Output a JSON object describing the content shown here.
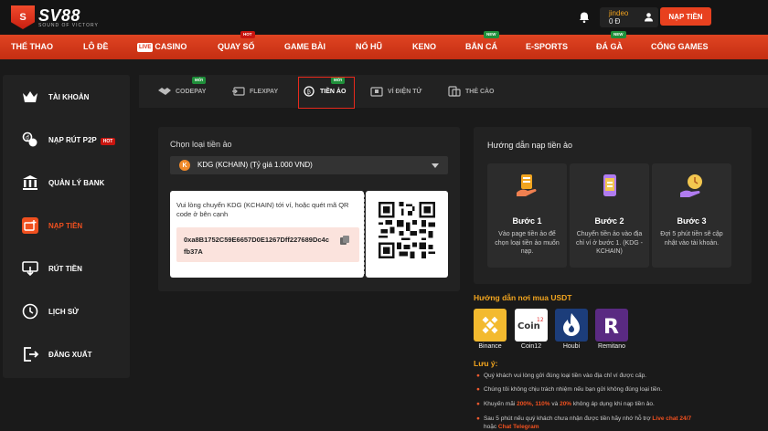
{
  "header": {
    "logo_text": "SV88",
    "logo_tagline": "SOUND OF VICTORY",
    "username": "jindeo",
    "balance": "0 Đ",
    "deposit_button": "NẠP TIỀN"
  },
  "nav": {
    "items": [
      {
        "label": "THỂ THAO"
      },
      {
        "label": "LÔ ĐỀ"
      },
      {
        "label": "CASINO",
        "live": "LIVE"
      },
      {
        "label": "QUAY SỐ",
        "badge": "HOT"
      },
      {
        "label": "GAME BÀI"
      },
      {
        "label": "NỔ HŨ"
      },
      {
        "label": "KENO"
      },
      {
        "label": "BẮN CÁ",
        "badge": "NEW"
      },
      {
        "label": "E-SPORTS"
      },
      {
        "label": "ĐÁ GÀ",
        "badge": "NEW"
      },
      {
        "label": "CỔNG GAMES"
      }
    ]
  },
  "sidebar": {
    "items": [
      {
        "label": "TÀI KHOẢN"
      },
      {
        "label": "NẠP RÚT P2P",
        "badge": "HOT"
      },
      {
        "label": "QUẢN LÝ BANK"
      },
      {
        "label": "NẠP TIỀN",
        "active": true
      },
      {
        "label": "RÚT TIỀN"
      },
      {
        "label": "LỊCH SỬ"
      },
      {
        "label": "ĐĂNG XUẤT"
      }
    ]
  },
  "tabs": {
    "items": [
      {
        "label": "CODEPAY",
        "badge": "MỚI"
      },
      {
        "label": "FLEXPAY"
      },
      {
        "label": "TIỀN ẢO",
        "badge": "MỚI",
        "active": true
      },
      {
        "label": "VÍ ĐIỆN TỬ"
      },
      {
        "label": "THẺ CÀO"
      }
    ]
  },
  "panel": {
    "label": "Chọn loại tiền ảo",
    "selected": "KDG (KCHAIN) (Tỷ giá 1.000 VND)",
    "instruction": "Vui lòng chuyển KDG (KCHAIN) tới ví, hoặc quét mã QR code ở bên cạnh",
    "address": "0xa8B1752C59E6657D0E1267Dff227689Dc4cfb37A"
  },
  "guide": {
    "title": "Hướng dẫn nạp tiền ảo",
    "steps": [
      {
        "title": "Bước 1",
        "desc": "Vào page tiền ảo để chọn loại tiền ảo muốn nạp."
      },
      {
        "title": "Bước 2",
        "desc": "Chuyển tiền ảo vào địa chỉ ví ở bước 1. (KDG - KCHAIN)"
      },
      {
        "title": "Bước 3",
        "desc": "Đợi 5 phút tiền sẽ cập nhật vào tài khoản."
      }
    ]
  },
  "buy": {
    "title": "Hướng dẫn nơi mua USDT",
    "exchanges": [
      {
        "name": "Binance",
        "color": "#f3ba2f"
      },
      {
        "name": "Coin12",
        "color": "#ffffff"
      },
      {
        "name": "Houbi",
        "color": "#1c3d7a"
      },
      {
        "name": "Remitano",
        "color": "#5a2a82"
      }
    ]
  },
  "notes": {
    "title": "Lưu ý:",
    "n1": "Quý khách vui lòng gửi đúng loại tiền vào địa chỉ ví được cấp.",
    "n2": "Chúng tôi không chịu trách nhiệm nếu bạn gửi không đúng loại tiền.",
    "n3_a": "Khuyến mãi ",
    "n3_b": "200%, 110%",
    "n3_c": " và ",
    "n3_d": "20%",
    "n3_e": " không áp dụng khi nạp tiền ảo.",
    "n4_a": "Sau 5 phút nếu quý khách chưa nhận được tiền hãy nhớ hỗ trợ ",
    "n4_b": "Live chat 24/7",
    "n4_c": "hoặc ",
    "n4_d": "Chat Telegram"
  },
  "colors": {
    "accent": "#e8411f",
    "gold": "#f2a51f"
  }
}
